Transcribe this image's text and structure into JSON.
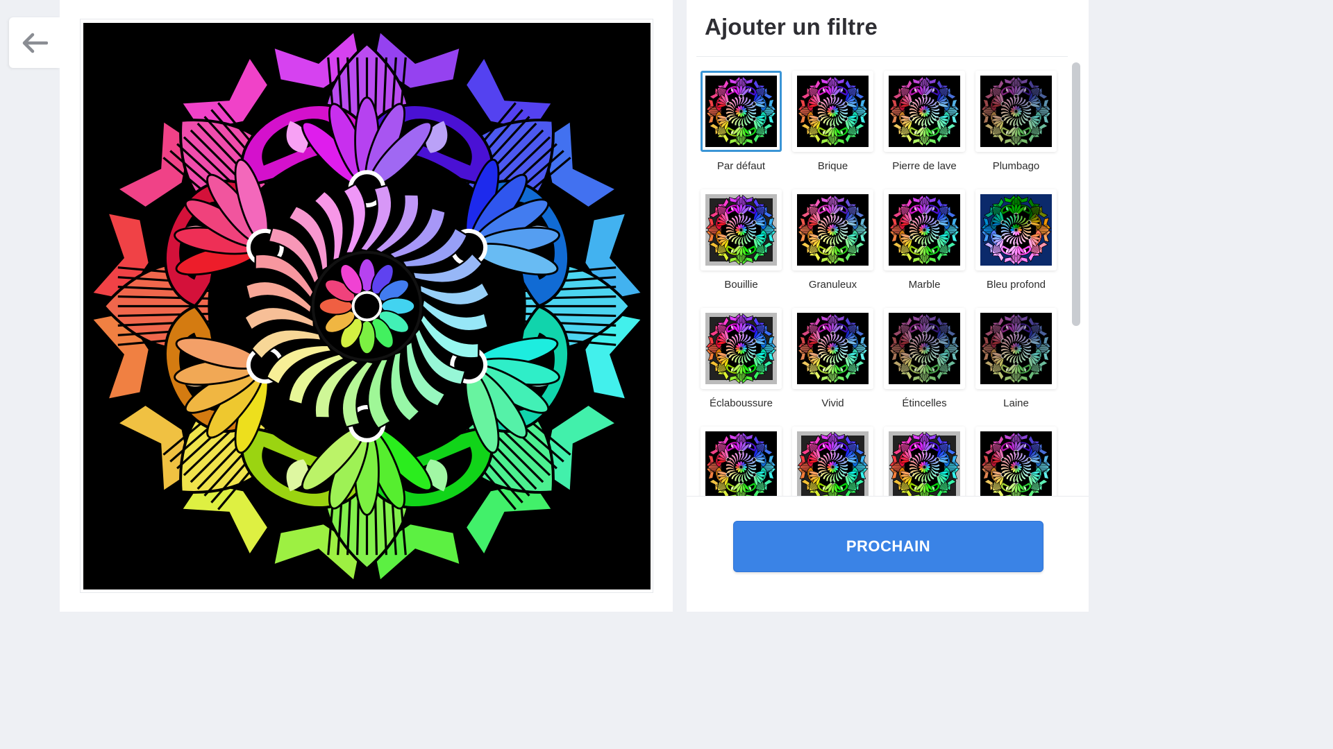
{
  "navigation": {
    "back_icon": "arrow-left-icon"
  },
  "sidebar": {
    "title": "Ajouter un filtre",
    "next_button": "PROCHAIN",
    "filters": [
      {
        "label": "Par défaut",
        "selected": true,
        "style": "default"
      },
      {
        "label": "Brique",
        "selected": false,
        "style": "default"
      },
      {
        "label": "Pierre de lave",
        "selected": false,
        "style": "grain"
      },
      {
        "label": "Plumbago",
        "selected": false,
        "style": "muted"
      },
      {
        "label": "Bouillie",
        "selected": false,
        "style": "grey"
      },
      {
        "label": "Granuleux",
        "selected": false,
        "style": "gold"
      },
      {
        "label": "Marble",
        "selected": false,
        "style": "default"
      },
      {
        "label": "Bleu profond",
        "selected": false,
        "style": "blue"
      },
      {
        "label": "Éclaboussure",
        "selected": false,
        "style": "grey"
      },
      {
        "label": "Vivid",
        "selected": false,
        "style": "grain"
      },
      {
        "label": "Étincelles",
        "selected": false,
        "style": "muted"
      },
      {
        "label": "Laine",
        "selected": false,
        "style": "muted"
      },
      {
        "label": "",
        "selected": false,
        "style": "default"
      },
      {
        "label": "",
        "selected": false,
        "style": "grey"
      },
      {
        "label": "",
        "selected": false,
        "style": "grey"
      },
      {
        "label": "",
        "selected": false,
        "style": "grain"
      }
    ]
  },
  "colors": {
    "accent": "#3a83e6",
    "selected_border": "#3a95d6",
    "canvas_background": "#000000"
  }
}
